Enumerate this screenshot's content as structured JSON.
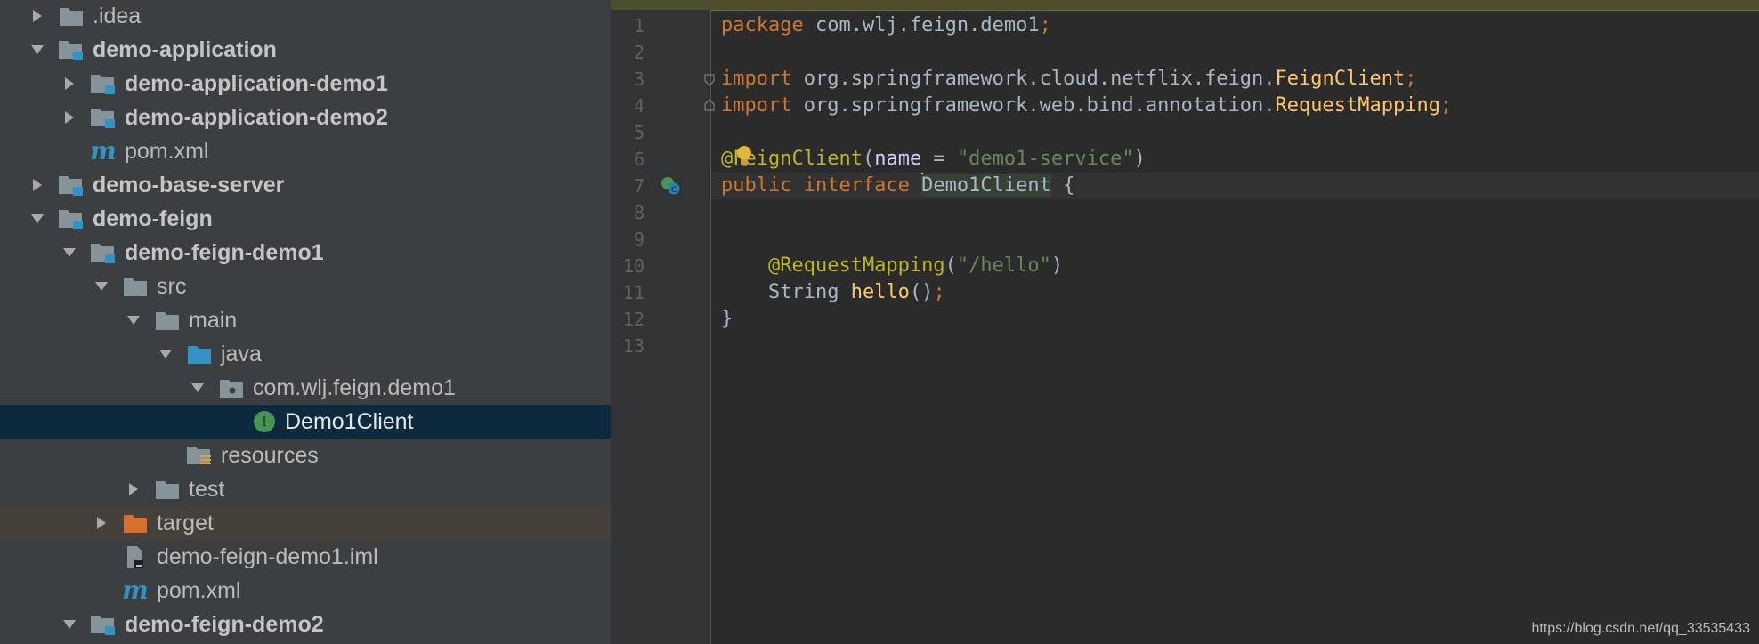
{
  "project_tree": {
    "items": [
      {
        "label": ".idea",
        "bold": false
      },
      {
        "label": "demo-application",
        "bold": true
      },
      {
        "label": "demo-application-demo1",
        "bold": true
      },
      {
        "label": "demo-application-demo2",
        "bold": true
      },
      {
        "label": "pom.xml",
        "bold": false
      },
      {
        "label": "demo-base-server",
        "bold": true
      },
      {
        "label": "demo-feign",
        "bold": true
      },
      {
        "label": "demo-feign-demo1",
        "bold": true
      },
      {
        "label": "src",
        "bold": false
      },
      {
        "label": "main",
        "bold": false
      },
      {
        "label": "java",
        "bold": false
      },
      {
        "label": "com.wlj.feign.demo1",
        "bold": false
      },
      {
        "label": "Demo1Client",
        "bold": false
      },
      {
        "label": "resources",
        "bold": false
      },
      {
        "label": "test",
        "bold": false
      },
      {
        "label": "target",
        "bold": false
      },
      {
        "label": "demo-feign-demo1.iml",
        "bold": false
      },
      {
        "label": "pom.xml",
        "bold": false
      },
      {
        "label": "demo-feign-demo2",
        "bold": true
      }
    ],
    "selected_item": "Demo1Client"
  },
  "editor": {
    "line_numbers": [
      "1",
      "2",
      "3",
      "4",
      "5",
      "6",
      "7",
      "8",
      "9",
      "10",
      "11",
      "12",
      "13"
    ],
    "code": {
      "l1_kw": "package",
      "l1_pkg": " com.wlj.feign.demo1",
      "l1_semi": ";",
      "l3_kw": "import",
      "l3_path": " org.springframework.cloud.netflix.feign.",
      "l3_cls": "FeignClient",
      "l3_semi": ";",
      "l4_kw": "import",
      "l4_path": " org.springframework.web.bind.annotation.",
      "l4_cls": "RequestMapping",
      "l4_semi": ";",
      "l6_ann": "@FeignClient",
      "l6_open": "(",
      "l6_param": "name",
      "l6_eq": " = ",
      "l6_str": "\"demo1-service\"",
      "l6_close": ")",
      "l7_kw": "public interface ",
      "l7_name": "Demo1Client",
      "l7_brace": " {",
      "l10_indent": "    ",
      "l10_ann": "@RequestMapping",
      "l10_open": "(",
      "l10_str": "\"/hello\"",
      "l10_close": ")",
      "l11_indent": "    ",
      "l11_type": "String ",
      "l11_fn": "hello",
      "l11_parens": "()",
      "l11_semi": ";",
      "l12_brace": "}"
    }
  },
  "watermark": "https://blog.csdn.net/qq_33535433",
  "colors": {
    "keyword": "#cc7832",
    "annotation": "#bbb529",
    "string": "#6a8759",
    "method": "#ffc66d",
    "selection": "#0d293e"
  }
}
